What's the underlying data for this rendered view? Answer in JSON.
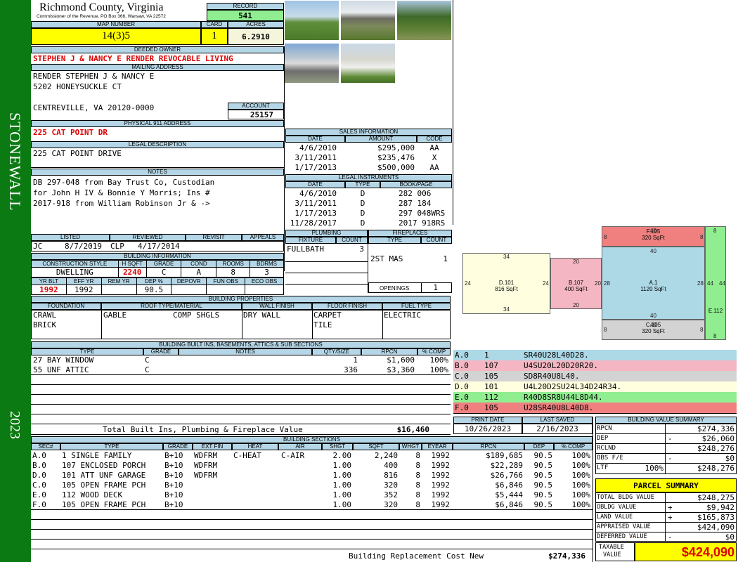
{
  "sidebar": {
    "district": "STONEWALL",
    "year": "2023"
  },
  "header": {
    "county": "Richmond County, Virginia",
    "commissioner": "Commissioner of the Revenue, PO Box 366, Warsaw, VA 22572",
    "record_label": "RECORD",
    "record": "541",
    "map_label": "MAP NUMBER",
    "map_number": "14(3)5",
    "card_label": "CARD",
    "card": "1",
    "acres_label": "ACRES",
    "acres": "6.2910"
  },
  "owner": {
    "deeded_label": "DEEDED OWNER",
    "deeded": "STEPHEN J & NANCY E RENDER REVOCABLE LIVING",
    "mailing_label": "MAILING ADDRESS",
    "mail_line1": "RENDER STEPHEN J & NANCY E",
    "mail_line2": "5202 HONEYSUCKLE CT",
    "mail_line3": "CENTREVILLE, VA 20120-0000",
    "account_label": "ACCOUNT",
    "account": "25157",
    "physical_label": "PHYSICAL 911 ADDRESS",
    "physical": "225 CAT POINT DR",
    "legal_label": "LEGAL DESCRIPTION",
    "legal": "225 CAT POINT DRIVE",
    "notes_label": "NOTES",
    "notes1": "DB 297-048 from Bay Trust Co, Custodian",
    "notes2": "for John H IV & Bonnie Y Morris; Ins #",
    "notes3": "2017-918 from William Robinson Jr & ->"
  },
  "sales": {
    "title": "SALES INFORMATION",
    "headers": [
      "DATE",
      "AMOUNT",
      "CODE"
    ],
    "rows": [
      [
        "4/6/2010",
        "$295,000",
        "AA"
      ],
      [
        "3/11/2011",
        "$235,476",
        "X"
      ],
      [
        "1/17/2013",
        "$500,000",
        "AA"
      ]
    ]
  },
  "legal_instruments": {
    "title": "LEGAL INSTRUMENTS",
    "headers": [
      "DATE",
      "TYPE",
      "BOOK/PAGE"
    ],
    "rows": [
      [
        "4/6/2010",
        "D",
        "282 006"
      ],
      [
        "3/11/2011",
        "D",
        "287 184"
      ],
      [
        "1/17/2013",
        "D",
        "297 048WRS"
      ],
      [
        "11/28/2017",
        "D",
        "2017 918RS"
      ]
    ]
  },
  "review": {
    "headers": [
      "LISTED",
      "REVIEWED",
      "REVISIT",
      "APPEALS"
    ],
    "listed_by": "JC",
    "listed_date": "8/7/2019",
    "reviewed_by": "CLP",
    "reviewed_date": "4/17/2014"
  },
  "plumbing": {
    "title": "PLUMBING",
    "headers": [
      "FIXTURE",
      "COUNT"
    ],
    "fixture": "FULLBATH",
    "count": "3"
  },
  "fireplaces": {
    "title": "FIREPLACES",
    "headers": [
      "TYPE",
      "COUNT"
    ],
    "type": "2ST MAS",
    "count": "1",
    "openings_label": "OPENINGS",
    "openings": "1"
  },
  "building_info": {
    "title": "BUILDING INFORMATION",
    "headers1": [
      "CONSTRUCTION STYLE",
      "H SQFT",
      "GRADE",
      "COND",
      "ROOMS",
      "BDRMS"
    ],
    "values1": [
      "DWELLING",
      "2240",
      "C",
      "A",
      "8",
      "3"
    ],
    "headers2": [
      "YR BLT",
      "EFF YR",
      "REM YR",
      "DEP %",
      "DEPOVR",
      "FUN OBS",
      "ECO OBS"
    ],
    "values2": [
      "1992",
      "1992",
      "",
      "90.5",
      "",
      "",
      ""
    ]
  },
  "building_props": {
    "title": "BUILDING PROPERTIES",
    "headers": [
      "FOUNDATION",
      "ROOF TYPE/MATERIAL",
      "WALL FINISH",
      "FLOOR FINISH",
      "FUEL TYPE"
    ],
    "foundation": [
      "CRAWL",
      "BRICK"
    ],
    "roof_type": "GABLE",
    "roof_material": "COMP SHGLS",
    "wall": "DRY WALL",
    "floor": [
      "CARPET",
      "TILE"
    ],
    "fuel": "ELECTRIC"
  },
  "builtins": {
    "title": "BUILDING BUILT INS, BASEMENTS, ATTICS & SUB SECTIONS",
    "headers": [
      "TYPE",
      "GRADE",
      "NOTES",
      "QTY/SIZE",
      "RPCN",
      "% COMP"
    ],
    "rows": [
      [
        "27 BAY WINDOW",
        "C",
        "",
        "1",
        "$1,600",
        "100%"
      ],
      [
        "55 UNF ATTIC",
        "C",
        "",
        "336",
        "$3,360",
        "100%"
      ]
    ],
    "total_label": "Total Built Ins, Plumbing & Fireplace Value",
    "total": "$16,460"
  },
  "print": {
    "print_label": "PRINT DATE",
    "print_date": "10/26/2023",
    "saved_label": "LAST SAVED",
    "saved_date": "2/16/2023"
  },
  "sections": {
    "title": "BUILDING SECTIONS",
    "headers": [
      "SEC#",
      "TYPE",
      "GRADE",
      "EXT FIN",
      "HEAT",
      "AIR",
      "SHGT",
      "SQFT",
      "WHGT",
      "EYEAR",
      "RPCN",
      "DEP",
      "% COMP"
    ],
    "rows": [
      [
        "A.0",
        "1 SINGLE FAMILY",
        "B+10",
        "WDFRM",
        "C-HEAT",
        "C-AIR",
        "2.00",
        "2,240",
        "8",
        "1992",
        "$189,685",
        "90.5",
        "100%"
      ],
      [
        "B.0",
        "107 ENCLOSED PORCH",
        "B+10",
        "WDFRM",
        "",
        "",
        "1.00",
        "400",
        "8",
        "1992",
        "$22,289",
        "90.5",
        "100%"
      ],
      [
        "D.0",
        "101 ATT UNF GARAGE",
        "B+10",
        "WDFRM",
        "",
        "",
        "1.00",
        "816",
        "8",
        "1992",
        "$26,766",
        "90.5",
        "100%"
      ],
      [
        "C.0",
        "105 OPEN FRAME PCH",
        "B+10",
        "",
        "",
        "",
        "1.00",
        "320",
        "8",
        "1992",
        "$6,846",
        "90.5",
        "100%"
      ],
      [
        "E.0",
        "112 WOOD DECK",
        "B+10",
        "",
        "",
        "",
        "1.00",
        "352",
        "8",
        "1992",
        "$5,444",
        "90.5",
        "100%"
      ],
      [
        "F.0",
        "105 OPEN FRAME PCH",
        "B+10",
        "",
        "",
        "",
        "1.00",
        "320",
        "8",
        "1992",
        "$6,846",
        "90.5",
        "100%"
      ]
    ],
    "replacement_label": "Building Replacement Cost New",
    "replacement": "$274,336"
  },
  "sketch": {
    "shapes": [
      {
        "id": "D.101",
        "area": "816 SqFt",
        "color": "#ffffe0"
      },
      {
        "id": "B.107",
        "area": "400 SqFt",
        "color": "#f4b6c2"
      },
      {
        "id": "A.1",
        "area": "1120 SqFt",
        "color": "#add8e6"
      },
      {
        "id": "F.105",
        "area": "320 SqFt",
        "color": "#f08080"
      },
      {
        "id": "C.105",
        "area": "320 SqFt",
        "color": "#d3d3d3"
      },
      {
        "id": "E.112",
        "area": "",
        "color": "#90ee90"
      }
    ],
    "dims": {
      "d_top": "34",
      "d_bottom": "34",
      "d_left": "24",
      "d_right": "24",
      "b_top": "20",
      "b_bottom": "20",
      "b_right": "20",
      "a_left": "28",
      "a_right": "28",
      "a_top": "40",
      "a_bottom": "40",
      "f_top": "40",
      "f_left": "8",
      "f_right": "8",
      "c_bottom": "40",
      "c_left": "8",
      "c_right": "8",
      "e_top": "8",
      "e_bottom": "8",
      "e_left": "44",
      "e_right": "44"
    }
  },
  "codes": [
    {
      "sec": "A.0",
      "num": "1",
      "path": "SR40U28L40D28.",
      "color": "#add8e6"
    },
    {
      "sec": "B.0",
      "num": "107",
      "path": "U4SU20L20D20R20.",
      "color": "#f4b6c2"
    },
    {
      "sec": "C.0",
      "num": "105",
      "path": "SD8R40U8L40.",
      "color": "#d3d3d3"
    },
    {
      "sec": "D.0",
      "num": "101",
      "path": "U4L20D2SU24L34D24R34.",
      "color": "#ffffe0"
    },
    {
      "sec": "E.0",
      "num": "112",
      "path": "R40D8SR8U44L8D44.",
      "color": "#90ee90"
    },
    {
      "sec": "F.0",
      "num": "105",
      "path": "U28SR40U8L40D8.",
      "color": "#f08080"
    }
  ],
  "value_summary": {
    "title": "BUILDING VALUE SUMMARY",
    "rpcn_label": "RPCN",
    "rpcn": "$274,336",
    "dep_label": "DEP",
    "dep_sign": "-",
    "dep": "$26,060",
    "rclnd_label": "RCLND",
    "rclnd": "$248,276",
    "obs_label": "OBS F/E",
    "obs_sign": "-",
    "obs": "$0",
    "ltf_label": "LTF",
    "ltf_pct": "100%",
    "ltf": "$248,276"
  },
  "parcel": {
    "title": "PARCEL SUMMARY",
    "total_bldg_label": "TOTAL BLDG VALUE",
    "total_bldg": "$248,275",
    "obldg_label": "OBLDG VALUE",
    "obldg_sign": "+",
    "obldg": "$9,942",
    "land_label": "LAND VALUE",
    "land_sign": "+",
    "land": "$165,873",
    "appraised_label": "APPRAISED VALUE",
    "appraised": "$424,090",
    "deferred_label": "DEFERRED VALUE",
    "deferred_sign": "-",
    "deferred": "$0",
    "taxable_label1": "TAXABLE",
    "taxable_label2": "VALUE",
    "taxable": "$424,090"
  }
}
